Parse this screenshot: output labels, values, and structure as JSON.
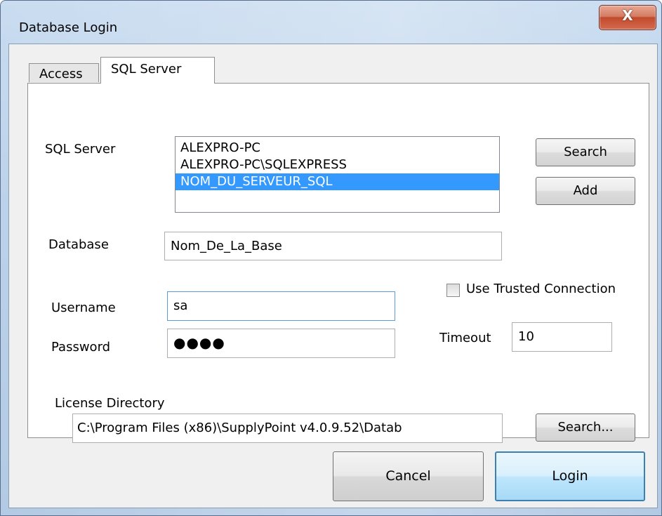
{
  "window": {
    "title": "Database Login",
    "close_glyph": "X"
  },
  "tabs": [
    {
      "label": "Access"
    },
    {
      "label": "SQL Server"
    }
  ],
  "sql_server": {
    "label": "SQL Server",
    "servers": [
      "ALEXPRO-PC",
      "ALEXPRO-PC\\SQLEXPRESS",
      "NOM_DU_SERVEUR_SQL"
    ],
    "selected_index": 2,
    "search_label": "Search",
    "add_label": "Add"
  },
  "database": {
    "label": "Database",
    "value": "Nom_De_La_Base"
  },
  "credentials": {
    "username_label": "Username",
    "username_value": "sa",
    "password_label": "Password",
    "password_mask": "●●●●"
  },
  "trusted_connection": {
    "label": "Use Trusted Connection",
    "checked": false
  },
  "timeout": {
    "label": "Timeout",
    "value": "10"
  },
  "license": {
    "label": "License Directory",
    "value": "C:\\Program Files (x86)\\SupplyPoint v4.0.9.52\\Datab",
    "search_label": "Search..."
  },
  "dialog_buttons": {
    "cancel_label": "Cancel",
    "login_label": "Login"
  },
  "colors": {
    "selection": "#3399ff",
    "default_button_border": "#3c7fb1",
    "close_button": "#c24a2c"
  }
}
